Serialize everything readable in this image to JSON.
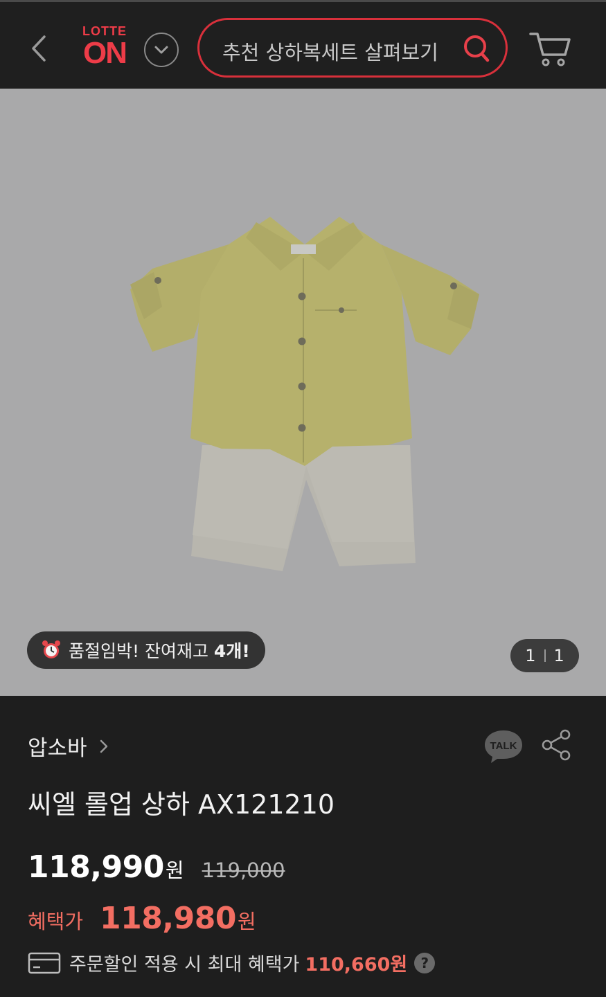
{
  "header": {
    "logo_top": "LOTTE",
    "logo_main": "ON",
    "search_text": "추천 상하복세트 살펴보기",
    "icons": [
      "back-arrow-icon",
      "chevron-down-icon",
      "search-icon",
      "cart-icon"
    ],
    "accent_color": "#ee3c48"
  },
  "gallery": {
    "stock_prefix": "품절임박! 잔여재고 ",
    "stock_count": "4개!",
    "current_page": "1",
    "total_pages": "1"
  },
  "product": {
    "brand": "압소바",
    "title": "씨엘 롤업 상하 AX121210",
    "price": "118,990",
    "price_unit": "원",
    "original_price": "119,000",
    "benefit_label": "혜택가",
    "benefit_price": "118,980",
    "benefit_unit": "원",
    "card_text": "주문할인 적용 시 최대 혜택가",
    "card_value": "110,660원",
    "talk_label": "TALK",
    "price_color": "#f36e62"
  }
}
